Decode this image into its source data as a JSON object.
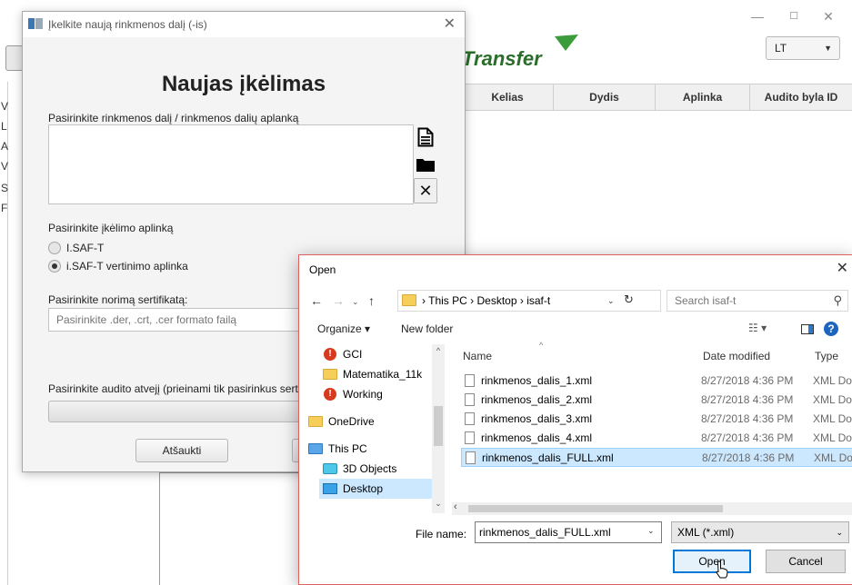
{
  "main_window": {
    "brand": "Transfer",
    "language": "LT",
    "side_letters": [
      "V",
      "L",
      "A",
      "V",
      "S",
      "F"
    ],
    "columns": [
      "Kelias",
      "Dydis",
      "Aplinka",
      "Audito byla ID"
    ]
  },
  "upload_dialog": {
    "title": "Įkelkite naują rinkmenos dalį (-is)",
    "heading": "Naujas įkėlimas",
    "file_label": "Pasirinkite rinkmenos dalį / rinkmenos dalių aplanką",
    "env_label": "Pasirinkite įkėlimo aplinką",
    "env_options": [
      {
        "label": "I.SAF-T",
        "selected": false
      },
      {
        "label": "i.SAF-T vertinimo aplinka",
        "selected": true
      }
    ],
    "cert_label": "Pasirinkite norimą  sertifikatą:",
    "cert_placeholder": "Pasirinkite .der, .crt, .cer formato failą",
    "audit_label": "Pasirinkite audito atvejį (prieinami tik pasirinkus sert",
    "cancel_label": "Atšaukti"
  },
  "open_dialog": {
    "title": "Open",
    "path": {
      "this_pc": "This PC",
      "desktop": "Desktop",
      "folder": "isaf-t"
    },
    "search_placeholder": "Search isaf-t",
    "organize_label": "Organize ▾",
    "new_folder_label": "New folder",
    "nav_items": [
      {
        "label": "GCI",
        "icon": "warning-folder-icon"
      },
      {
        "label": "Matematika_11k",
        "icon": "folder-icon"
      },
      {
        "label": "Working",
        "icon": "warning-folder-icon"
      },
      {
        "label": "OneDrive",
        "icon": "onedrive-icon"
      },
      {
        "label": "This PC",
        "icon": "computer-icon"
      },
      {
        "label": "3D Objects",
        "icon": "3d-objects-icon"
      },
      {
        "label": "Desktop",
        "icon": "desktop-icon"
      }
    ],
    "columns": {
      "name": "Name",
      "date": "Date modified",
      "type": "Type"
    },
    "files": [
      {
        "name": "rinkmenos_dalis_1.xml",
        "date": "8/27/2018 4:36 PM",
        "type": "XML Do"
      },
      {
        "name": "rinkmenos_dalis_2.xml",
        "date": "8/27/2018 4:36 PM",
        "type": "XML Do"
      },
      {
        "name": "rinkmenos_dalis_3.xml",
        "date": "8/27/2018 4:36 PM",
        "type": "XML Do"
      },
      {
        "name": "rinkmenos_dalis_4.xml",
        "date": "8/27/2018 4:36 PM",
        "type": "XML Do"
      },
      {
        "name": "rinkmenos_dalis_FULL.xml",
        "date": "8/27/2018 4:36 PM",
        "type": "XML Do",
        "selected": true
      }
    ],
    "file_name_label": "File name:",
    "file_name_value": "rinkmenos_dalis_FULL.xml",
    "file_type": "XML (*.xml)",
    "open_label": "Open",
    "cancel_label": "Cancel"
  },
  "colors": {
    "accent": "#0078d7",
    "selection": "#cce8ff",
    "brand_green": "#2a6e2a",
    "dialog_border": "#e06060"
  }
}
